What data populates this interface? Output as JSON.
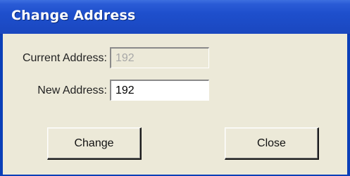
{
  "window": {
    "title": "Change Address"
  },
  "form": {
    "current_address_label": "Current Address:",
    "current_address_value": "192",
    "new_address_label": "New Address:",
    "new_address_value": "192"
  },
  "buttons": {
    "change_label": "Change",
    "close_label": "Close"
  },
  "colors": {
    "titlebar": "#1e4fcc",
    "dialog_background": "#ece9d8",
    "disabled_text": "#a7a7a7"
  }
}
